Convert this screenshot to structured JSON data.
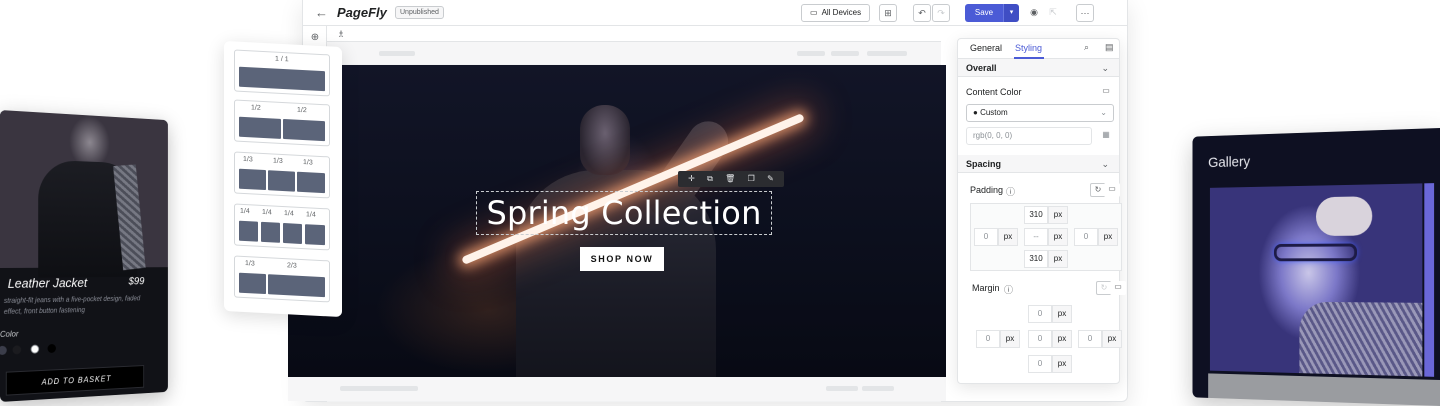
{
  "editor": {
    "logo": "PageFly",
    "status_badge": "Unpublished",
    "device_selector": "All Devices",
    "save_label": "Save"
  },
  "hero": {
    "title": "Spring Collection",
    "button": "SHOP NOW"
  },
  "panel": {
    "tabs": [
      "General",
      "Styling"
    ],
    "active_tab": "Styling",
    "overall": {
      "heading": "Overall",
      "content_color_label": "Content Color",
      "content_color_value": "Custom",
      "color_input_placeholder": "rgb(0, 0, 0)"
    },
    "spacing": {
      "heading": "Spacing",
      "padding_label": "Padding",
      "padding": {
        "top": "310",
        "right": "0",
        "bottom": "310",
        "left": "0",
        "center": "--",
        "unit": "px"
      },
      "margin_label": "Margin",
      "margin": {
        "top": "0",
        "right": "0",
        "bottom": "0",
        "left": "0",
        "center": "0",
        "unit": "px"
      }
    }
  },
  "layout_picker": {
    "options": [
      {
        "labels": [
          "1 / 1"
        ]
      },
      {
        "labels": [
          "1/2",
          "1/2"
        ]
      },
      {
        "labels": [
          "1/3",
          "1/3",
          "1/3"
        ]
      },
      {
        "labels": [
          "1/4",
          "1/4",
          "1/4",
          "1/4"
        ]
      },
      {
        "labels": [
          "1/3",
          "2/3"
        ]
      }
    ]
  },
  "product_card": {
    "name": "Leather Jacket",
    "price": "$99",
    "description": "straight-fit jeans with a five-pocket design, faded effect, front button fastening",
    "color_label": "Color",
    "add_to_basket": "ADD TO BASKET",
    "swatches": [
      "#3b3d4a",
      "#1b1b1f",
      "#ffffff",
      "#000000"
    ]
  },
  "gallery": {
    "title": "Gallery"
  },
  "colors": {
    "accent": "#4b5bd6"
  }
}
